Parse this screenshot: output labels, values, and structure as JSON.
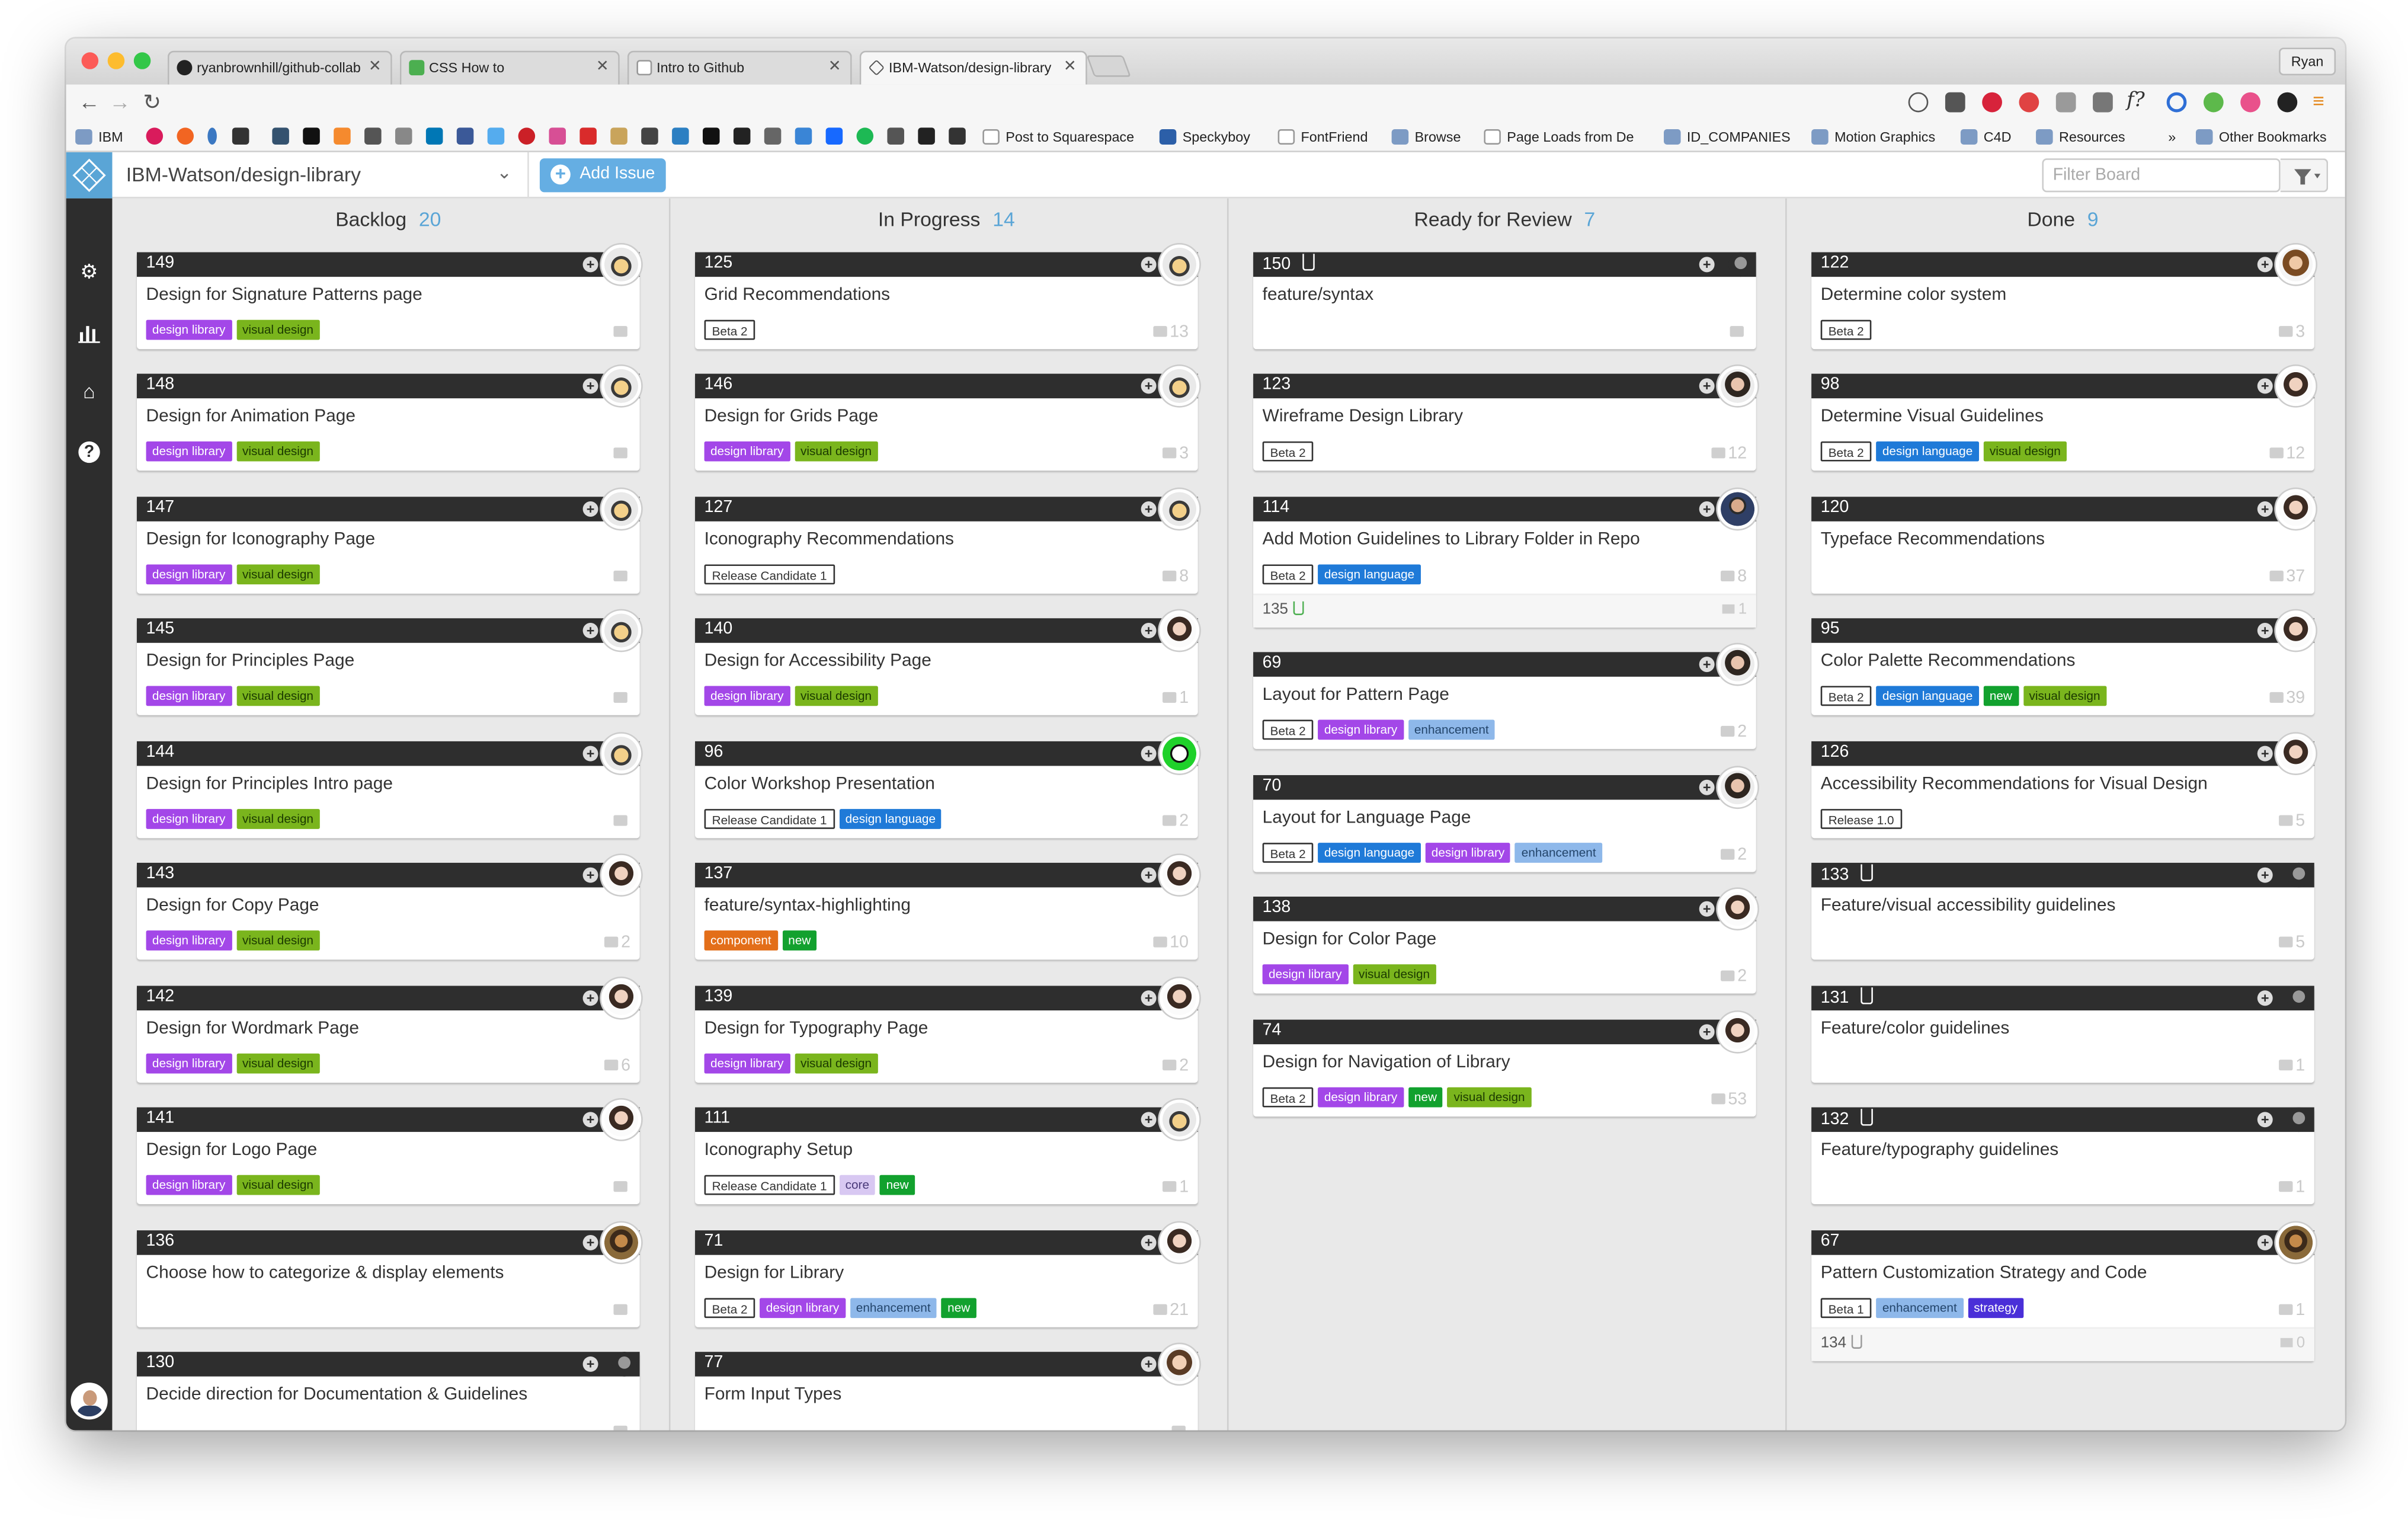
{
  "browser": {
    "tabs": [
      {
        "label": "ryanbrownhill/github-collab",
        "active": false
      },
      {
        "label": "CSS How to",
        "active": false
      },
      {
        "label": "Intro to Github",
        "active": false
      },
      {
        "label": "IBM-Watson/design-library",
        "active": true
      }
    ],
    "user": "Ryan"
  },
  "bookmarks": [
    "IBM",
    "Post to Squarespace",
    "Speckyboy",
    "FontFriend",
    "Browse",
    "Page Loads from De",
    "ID_COMPANIES",
    "Motion Graphics",
    "C4D",
    "Resources",
    "Other Bookmarks"
  ],
  "app": {
    "repo": "IBM-Watson/design-library",
    "add_issue": "Add Issue",
    "filter_placeholder": "Filter Board"
  },
  "label_colors": {
    "design library": {
      "bg": "#a347e8",
      "fg": "#ffffff"
    },
    "visual design": {
      "bg": "#7ab51d",
      "fg": "#1b3a00"
    },
    "Beta 2": {
      "bg": "#ffffff",
      "fg": "#333333",
      "border": "#333333"
    },
    "Beta 1": {
      "bg": "#ffffff",
      "fg": "#333333",
      "border": "#333333"
    },
    "Release Candidate 1": {
      "bg": "#ffffff",
      "fg": "#333333",
      "border": "#333333"
    },
    "Release 1.0": {
      "bg": "#ffffff",
      "fg": "#333333",
      "border": "#333333"
    },
    "design language": {
      "bg": "#1f7ad8",
      "fg": "#ffffff"
    },
    "component": {
      "bg": "#e36e19",
      "fg": "#ffffff"
    },
    "new": {
      "bg": "#12a12e",
      "fg": "#ffffff"
    },
    "core": {
      "bg": "#d8c8f2",
      "fg": "#4a3a7a"
    },
    "enhancement": {
      "bg": "#8eb8ea",
      "fg": "#23456b"
    },
    "strategy": {
      "bg": "#4a2fd8",
      "fg": "#ffffff"
    }
  },
  "columns": [
    {
      "title": "Backlog",
      "count": "20",
      "cards": [
        {
          "num": "149",
          "title": "Design for Signature Patterns page",
          "labels": [
            "design library",
            "visual design"
          ],
          "comments": "",
          "avatar": "raccoon"
        },
        {
          "num": "148",
          "title": "Design for Animation Page",
          "labels": [
            "design library",
            "visual design"
          ],
          "comments": "",
          "avatar": "raccoon"
        },
        {
          "num": "147",
          "title": "Design for Iconography Page",
          "labels": [
            "design library",
            "visual design"
          ],
          "comments": "",
          "avatar": "raccoon"
        },
        {
          "num": "145",
          "title": "Design for Principles Page",
          "labels": [
            "design library",
            "visual design"
          ],
          "comments": "",
          "avatar": "raccoon"
        },
        {
          "num": "144",
          "title": "Design for Principles Intro page",
          "labels": [
            "design library",
            "visual design"
          ],
          "comments": "",
          "avatar": "raccoon"
        },
        {
          "num": "143",
          "title": "Design for Copy Page",
          "labels": [
            "design library",
            "visual design"
          ],
          "comments": "2",
          "avatar": "woman"
        },
        {
          "num": "142",
          "title": "Design for Wordmark Page",
          "labels": [
            "design library",
            "visual design"
          ],
          "comments": "6",
          "avatar": "woman"
        },
        {
          "num": "141",
          "title": "Design for Logo Page",
          "labels": [
            "design library",
            "visual design"
          ],
          "comments": "",
          "avatar": "woman"
        },
        {
          "num": "136",
          "title": "Choose how to categorize & display elements",
          "labels": [],
          "comments": "",
          "avatar": "photo"
        },
        {
          "num": "130",
          "title": "Decide direction for Documentation & Guidelines",
          "labels": [],
          "comments": "",
          "avatar": "empty"
        }
      ]
    },
    {
      "title": "In Progress",
      "count": "14",
      "cards": [
        {
          "num": "125",
          "title": "Grid Recommendations",
          "labels": [
            "Beta 2"
          ],
          "comments": "13",
          "avatar": "raccoon"
        },
        {
          "num": "146",
          "title": "Design for Grids Page",
          "labels": [
            "design library",
            "visual design"
          ],
          "comments": "3",
          "avatar": "raccoon"
        },
        {
          "num": "127",
          "title": "Iconography Recommendations",
          "labels": [
            "Release Candidate 1"
          ],
          "comments": "8",
          "avatar": "raccoon"
        },
        {
          "num": "140",
          "title": "Design for Accessibility Page",
          "labels": [
            "design library",
            "visual design"
          ],
          "comments": "1",
          "avatar": "woman"
        },
        {
          "num": "96",
          "title": "Color Workshop Presentation",
          "labels": [
            "Release Candidate 1",
            "design language"
          ],
          "comments": "2",
          "avatar": "green"
        },
        {
          "num": "137",
          "title": "feature/syntax-highlighting",
          "labels": [
            "component",
            "new"
          ],
          "comments": "10",
          "avatar": "woman"
        },
        {
          "num": "139",
          "title": "Design for Typography Page",
          "labels": [
            "design library",
            "visual design"
          ],
          "comments": "2",
          "avatar": "woman"
        },
        {
          "num": "111",
          "title": "Iconography Setup",
          "labels": [
            "Release Candidate 1",
            "core",
            "new"
          ],
          "comments": "1",
          "avatar": "raccoon"
        },
        {
          "num": "71",
          "title": "Design for Library",
          "labels": [
            "Beta 2",
            "design library",
            "enhancement",
            "new"
          ],
          "comments": "21",
          "avatar": "woman"
        },
        {
          "num": "77",
          "title": "Form Input Types",
          "labels": [],
          "comments": "",
          "avatar": "woman2"
        }
      ]
    },
    {
      "title": "Ready for Review",
      "count": "7",
      "cards": [
        {
          "num": "150",
          "pr": true,
          "title": "feature/syntax",
          "labels": [],
          "comments": "",
          "avatar": "empty"
        },
        {
          "num": "123",
          "title": "Wireframe Design Library",
          "labels": [
            "Beta 2"
          ],
          "comments": "12",
          "avatar": "woman3"
        },
        {
          "num": "114",
          "title": "Add Motion Guidelines to Library Folder in Repo",
          "labels": [
            "Beta 2",
            "design language"
          ],
          "comments": "8",
          "avatar": "man",
          "sub": {
            "num": "135",
            "comments": "1",
            "pr_color": "green"
          }
        },
        {
          "num": "69",
          "title": "Layout for Pattern Page",
          "labels": [
            "Beta 2",
            "design library",
            "enhancement"
          ],
          "comments": "2",
          "avatar": "woman3"
        },
        {
          "num": "70",
          "title": "Layout for Language Page",
          "labels": [
            "Beta 2",
            "design language",
            "design library",
            "enhancement"
          ],
          "comments": "2",
          "avatar": "woman3"
        },
        {
          "num": "138",
          "title": "Design for Color Page",
          "labels": [
            "design library",
            "visual design"
          ],
          "comments": "2",
          "avatar": "woman"
        },
        {
          "num": "74",
          "title": "Design for Navigation of Library",
          "labels": [
            "Beta 2",
            "design library",
            "new",
            "visual design"
          ],
          "comments": "53",
          "avatar": "woman"
        }
      ]
    },
    {
      "title": "Done",
      "count": "9",
      "cards": [
        {
          "num": "122",
          "title": "Determine color system",
          "labels": [
            "Beta 2"
          ],
          "comments": "3",
          "avatar": "woman4"
        },
        {
          "num": "98",
          "title": "Determine Visual Guidelines",
          "labels": [
            "Beta 2",
            "design language",
            "visual design"
          ],
          "comments": "12",
          "avatar": "woman"
        },
        {
          "num": "120",
          "title": "Typeface Recommendations",
          "labels": [],
          "comments": "37",
          "avatar": "woman"
        },
        {
          "num": "95",
          "title": "Color Palette Recommendations",
          "labels": [
            "Beta 2",
            "design language",
            "new",
            "visual design"
          ],
          "comments": "39",
          "avatar": "woman"
        },
        {
          "num": "126",
          "title": "Accessibility Recommendations for Visual Design",
          "labels": [
            "Release 1.0"
          ],
          "comments": "5",
          "avatar": "woman"
        },
        {
          "num": "133",
          "pr": true,
          "title": "Feature/visual accessibility guidelines",
          "labels": [],
          "comments": "5",
          "avatar": "empty"
        },
        {
          "num": "131",
          "pr": true,
          "title": "Feature/color guidelines",
          "labels": [],
          "comments": "1",
          "avatar": "empty"
        },
        {
          "num": "132",
          "pr": true,
          "title": "Feature/typography guidelines",
          "labels": [],
          "comments": "1",
          "avatar": "empty"
        },
        {
          "num": "67",
          "title": "Pattern Customization Strategy and Code",
          "labels": [
            "Beta 1",
            "enhancement",
            "strategy"
          ],
          "comments": "1",
          "avatar": "photo",
          "sub": {
            "num": "134",
            "comments": "0",
            "pr_color": "gray"
          }
        }
      ]
    }
  ]
}
